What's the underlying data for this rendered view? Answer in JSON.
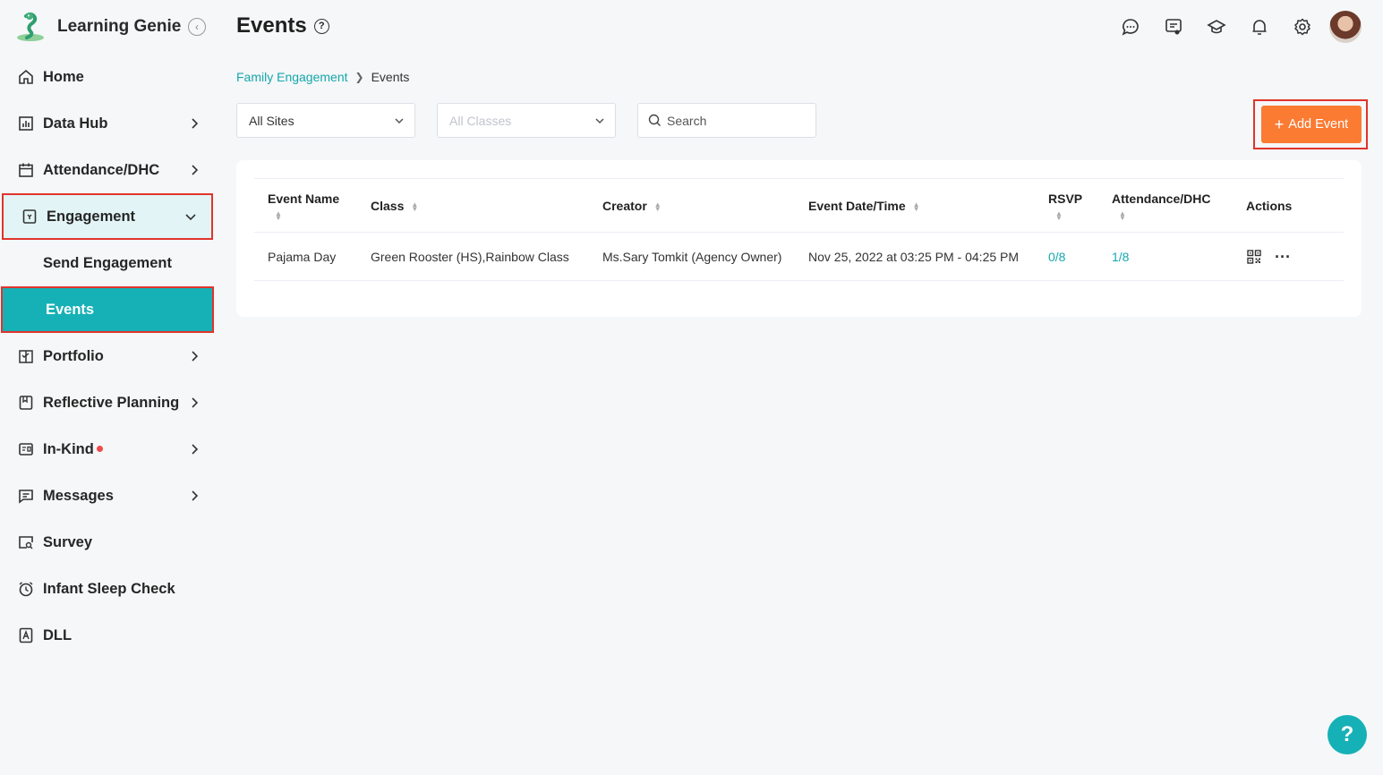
{
  "app": {
    "name": "Learning Genie"
  },
  "sidebar": {
    "items": [
      {
        "label": "Home",
        "icon": "home-icon"
      },
      {
        "label": "Data Hub",
        "icon": "chart-icon"
      },
      {
        "label": "Attendance/DHC",
        "icon": "calendar-icon"
      },
      {
        "label": "Engagement",
        "icon": "engagement-icon"
      },
      {
        "label": "Send Engagement"
      },
      {
        "label": "Events"
      },
      {
        "label": "Portfolio",
        "icon": "portfolio-icon"
      },
      {
        "label": "Reflective Planning",
        "icon": "planning-icon"
      },
      {
        "label": "In-Kind",
        "icon": "inkind-icon"
      },
      {
        "label": "Messages",
        "icon": "message-icon"
      },
      {
        "label": "Survey",
        "icon": "survey-icon"
      },
      {
        "label": "Infant Sleep Check",
        "icon": "clock-icon"
      },
      {
        "label": "DLL",
        "icon": "dll-icon"
      }
    ]
  },
  "header": {
    "title": "Events",
    "help": "?"
  },
  "breadcrumb": {
    "parent": "Family Engagement",
    "current": "Events"
  },
  "filters": {
    "site": "All Sites",
    "classes": "All Classes",
    "search_placeholder": "Search"
  },
  "add_button": {
    "label": "Add Event"
  },
  "table": {
    "columns": [
      "Event Name",
      "Class",
      "Creator",
      "Event Date/Time",
      "RSVP",
      "Attendance/DHC",
      "Actions"
    ],
    "rows": [
      {
        "event_name": "Pajama Day",
        "class": "Green Rooster (HS),Rainbow Class",
        "creator": "Ms.Sary Tomkit (Agency Owner)",
        "date_time": "Nov 25, 2022 at 03:25 PM - 04:25 PM",
        "rsvp": "0/8",
        "attendance": "1/8"
      }
    ]
  },
  "fab": {
    "label": "?"
  },
  "colors": {
    "accent": "#16b1b6",
    "primary_button": "#fb7b33",
    "highlight_border": "#e0342c"
  }
}
